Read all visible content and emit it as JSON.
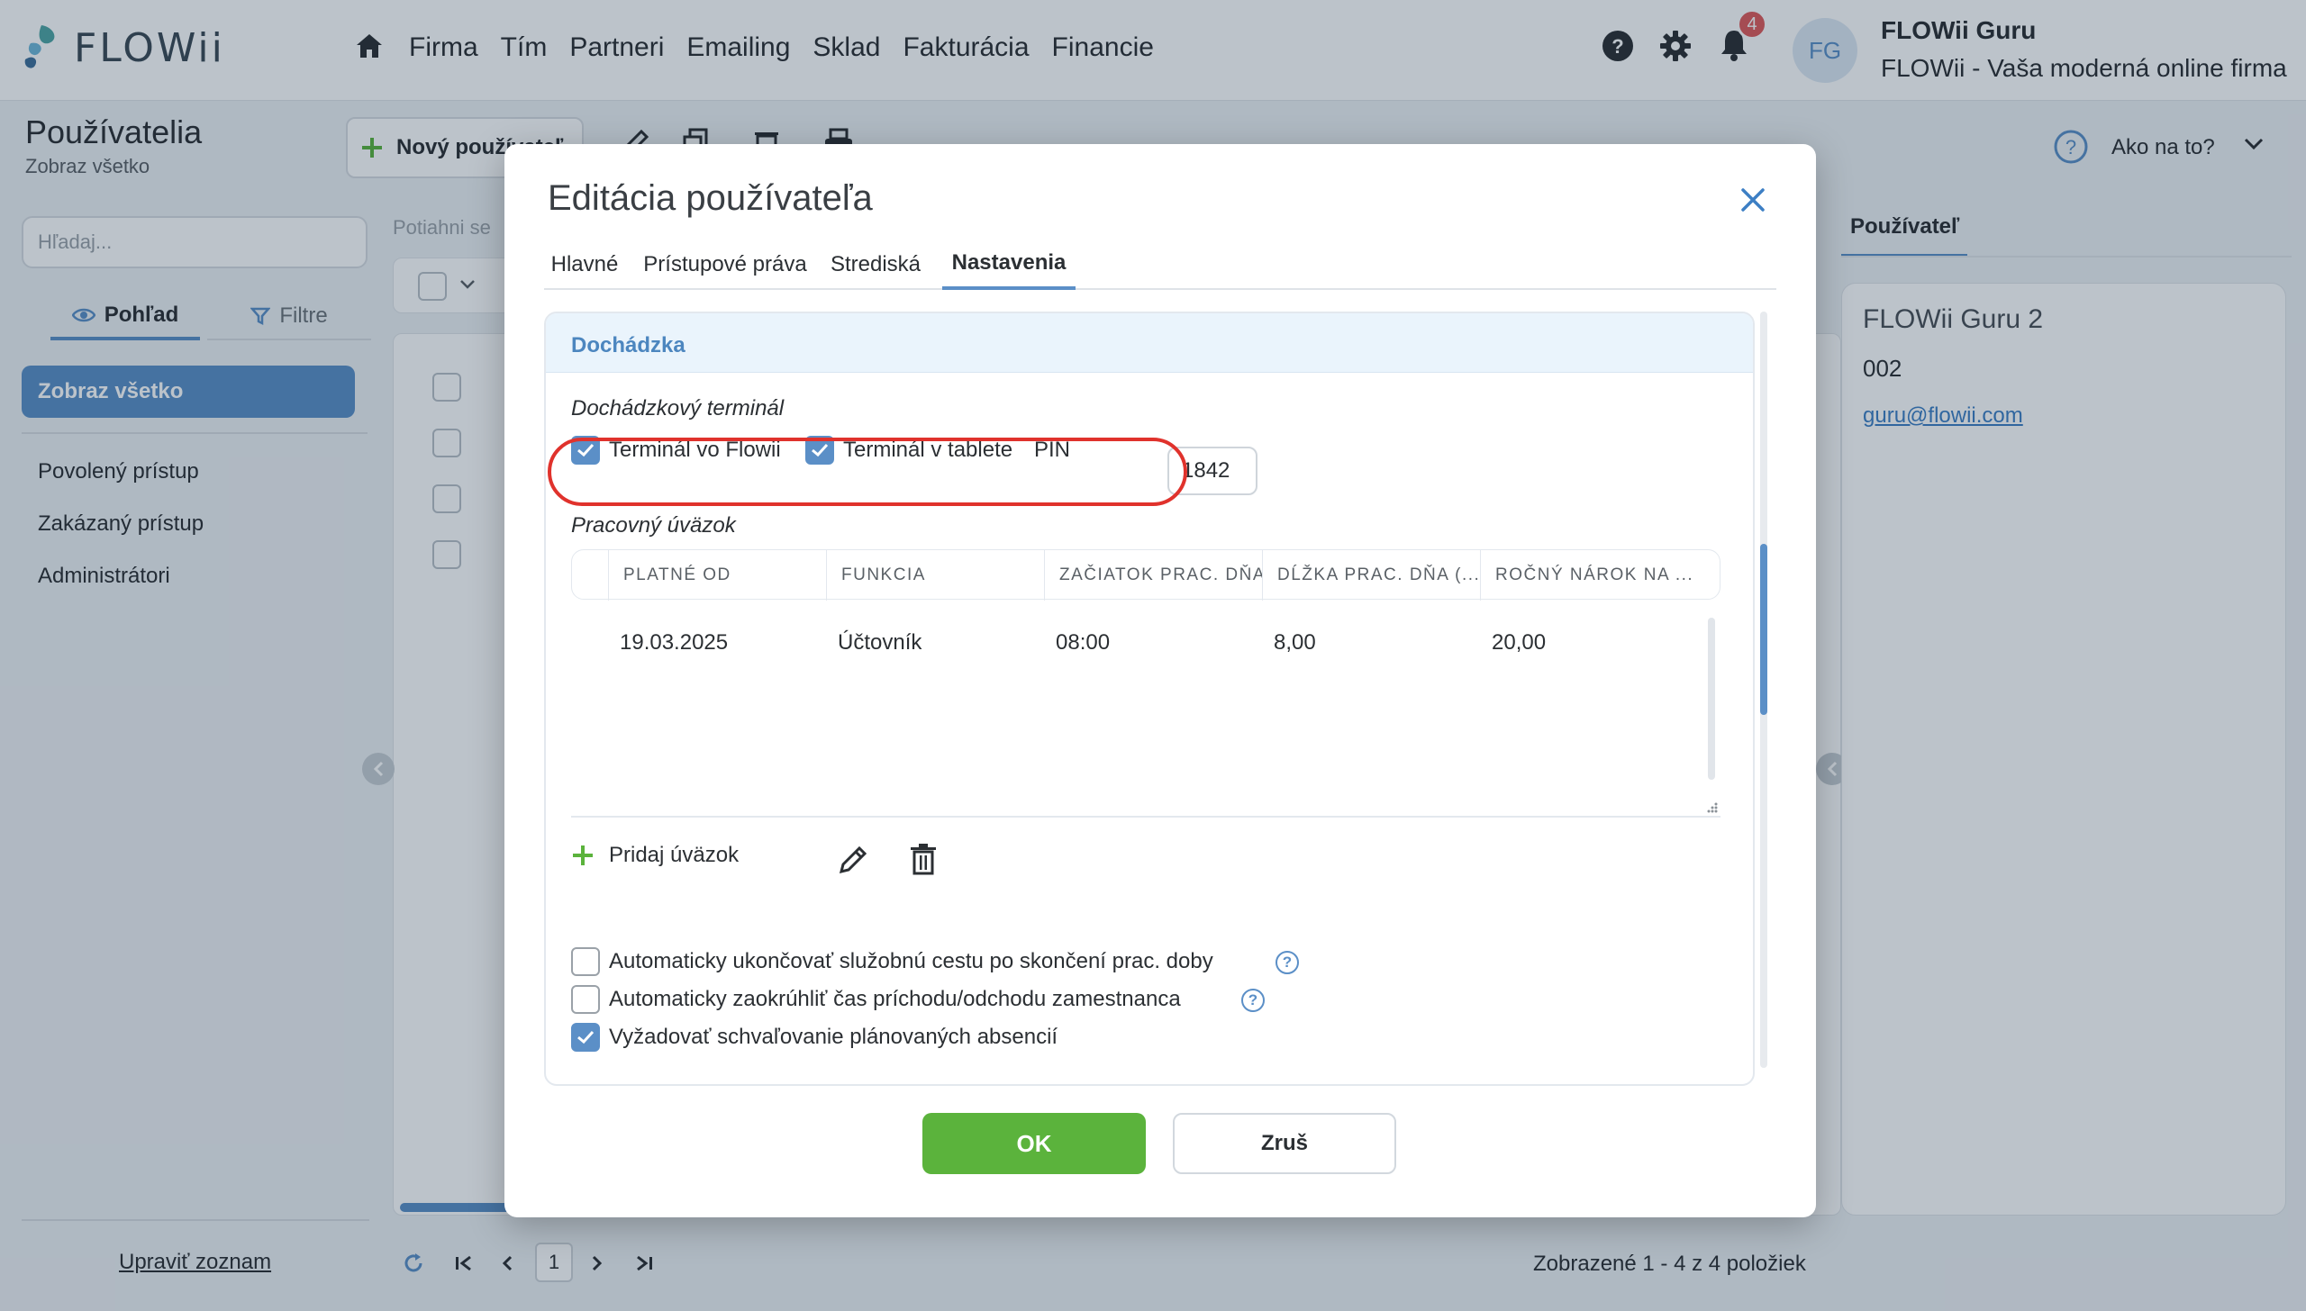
{
  "app": {
    "logo_text": "FLOWii"
  },
  "nav": {
    "items": [
      "Firma",
      "Tím",
      "Partneri",
      "Emailing",
      "Sklad",
      "Fakturácia",
      "Financie"
    ]
  },
  "header": {
    "notifications_count": "4",
    "avatar_initials": "FG",
    "user_name": "FLOWii Guru",
    "company": "FLOWii - Vaša moderná online firma"
  },
  "page": {
    "title": "Používatelia",
    "subtitle": "Zobraz všetko",
    "new_user_label": "Nový používateľ",
    "howto_label": "Ako na to?"
  },
  "sidebar": {
    "search_placeholder": "Hľadaj...",
    "tab_view": "Pohľad",
    "tab_filter": "Filtre",
    "active_item": "Zobraz všetko",
    "items": [
      "Povolený prístup",
      "Zakázaný prístup",
      "Administrátori"
    ],
    "edit_list": "Upraviť zoznam"
  },
  "list": {
    "drag_hint": "Potiahni se",
    "pager_page": "1",
    "pager_info": "Zobrazené 1 - 4 z 4 položiek"
  },
  "right_panel": {
    "tab": "Používateľ",
    "name": "FLOWii Guru 2",
    "code": "002",
    "email": "guru@flowii.com"
  },
  "modal": {
    "title": "Editácia používateľa",
    "tabs": [
      "Hlavné",
      "Prístupové práva",
      "Strediská",
      "Nastavenia"
    ],
    "active_tab": "Nastavenia",
    "section_title": "Dochádzka",
    "terminal_heading": "Dochádzkový terminál",
    "terminal_flowii": {
      "label": "Terminál vo Flowii",
      "checked": true
    },
    "terminal_tablet": {
      "label": "Terminál v tablete",
      "checked": true
    },
    "pin_label": "PIN",
    "pin_value": "1842",
    "workload_heading": "Pracovný úväzok",
    "grid": {
      "columns": [
        "PLATNÉ OD",
        "FUNKCIA",
        "ZAČIATOK PRAC. DŇA",
        "DĹŽKA PRAC. DŇA (...",
        "ROČNÝ NÁROK NA ..."
      ],
      "rows": [
        [
          "19.03.2025",
          "Účtovník",
          "08:00",
          "8,00",
          "20,00"
        ]
      ]
    },
    "add_workload": "Pridaj úväzok",
    "options": [
      {
        "label": "Automaticky ukončovať služobnú cestu po skončení prac. doby",
        "checked": false,
        "help": "?"
      },
      {
        "label": "Automaticky zaokrúhliť čas príchodu/odchodu zamestnanca",
        "checked": false,
        "help": "?"
      },
      {
        "label": "Vyžadovať schvaľovanie plánovaných absencií",
        "checked": true
      }
    ],
    "ok_label": "OK",
    "cancel_label": "Zruš"
  },
  "colors": {
    "accent": "#5b8fc7",
    "ok_green": "#5bb33c",
    "highlight_red": "#e0322c",
    "section_header_bg": "#eaf4fc"
  }
}
